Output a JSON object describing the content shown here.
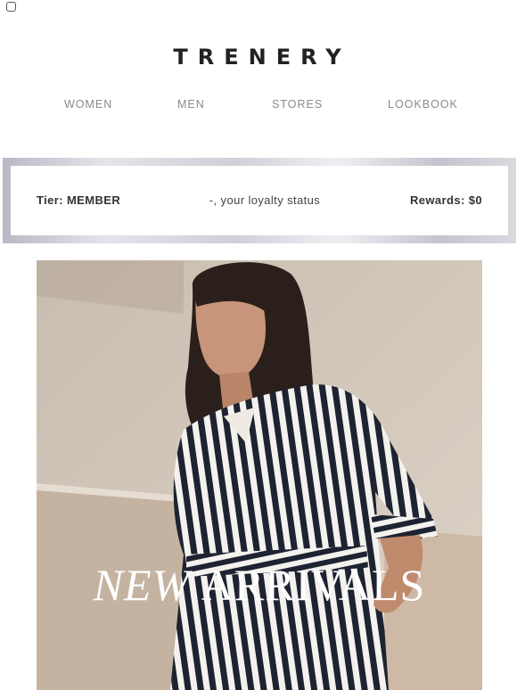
{
  "brand": {
    "logo_text": "TRENERY"
  },
  "nav": {
    "items": [
      "WOMEN",
      "MEN",
      "STORES",
      "LOOKBOOK"
    ]
  },
  "loyalty": {
    "tier": "Tier: MEMBER",
    "status": "-, your loyalty status",
    "rewards": "Rewards: $0"
  },
  "hero": {
    "title_word_1": "NEW",
    "title_word_2": "ARRIVALS"
  },
  "colors": {
    "text_dark": "#222222",
    "nav_grey": "#8a8a8a",
    "frame_silver": "#cfcfd8"
  }
}
